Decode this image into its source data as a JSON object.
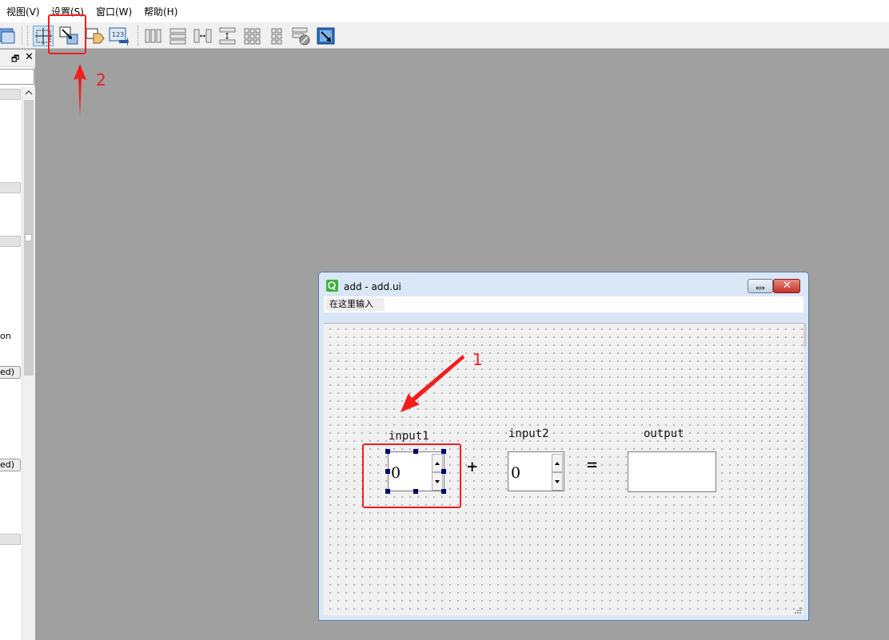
{
  "menu": {
    "items": [
      "视图(V)",
      "设置(S)",
      "窗口(W)",
      "帮助(H)"
    ]
  },
  "toolbar": {
    "buttons": [
      "edit-widgets-icon",
      "edit-signals-slots-icon",
      "edit-buddies-icon",
      "edit-tab-order-icon",
      "layout-horizontal-icon",
      "layout-vertical-icon",
      "layout-horizontal-splitter-icon",
      "layout-vertical-splitter-icon",
      "layout-grid-icon",
      "layout-form-icon",
      "break-layout-icon",
      "adjust-size-icon"
    ]
  },
  "dock": {
    "partial_text_1": "on",
    "partial_text_2": "ed)",
    "partial_text_3": "ed)"
  },
  "form": {
    "window_title": "add - add.ui",
    "menu_placeholder": "在这里输入",
    "label_input1": "input1",
    "label_input2": "input2",
    "label_output": "output",
    "plus_sign": "+",
    "equals_sign": "=",
    "input1_value": "0",
    "input2_value": "0",
    "output_value": ""
  },
  "annotations": {
    "marker_1": "1",
    "marker_2": "2",
    "color": "#f21d1d"
  }
}
